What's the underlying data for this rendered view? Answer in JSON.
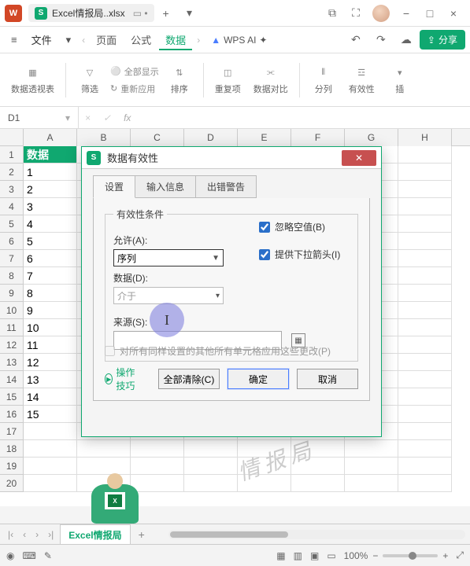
{
  "titlebar": {
    "wps_logo": "W",
    "file_icon_letter": "S",
    "file_name": "Excel情报局..xlsx",
    "add_tab": "+"
  },
  "menubar": {
    "hamburger": "≡",
    "file": "文件",
    "nav_prev": "‹",
    "page": "页面",
    "formula": "公式",
    "data": "数据",
    "nav_next": "›",
    "wps_ai_label": "WPS AI",
    "sparkle": "✦",
    "share": "分享"
  },
  "ribbon": {
    "pivot": "数据透视表",
    "filter": "筛选",
    "show_all": "全部显示",
    "reapply": "重新应用",
    "sort": "排序",
    "duplicates": "重复项",
    "compare": "数据对比",
    "split": "分列",
    "validity": "有效性",
    "insert_dd": "插"
  },
  "formula_bar": {
    "cell_ref": "D1",
    "fx": "fx"
  },
  "grid": {
    "cols": [
      "A",
      "B",
      "C",
      "D",
      "E",
      "F",
      "G",
      "H"
    ],
    "header_cell": "数据",
    "rows": [
      {
        "n": "1",
        "v": "数据"
      },
      {
        "n": "2",
        "v": "1"
      },
      {
        "n": "3",
        "v": "2"
      },
      {
        "n": "4",
        "v": "3"
      },
      {
        "n": "5",
        "v": "4"
      },
      {
        "n": "6",
        "v": "5"
      },
      {
        "n": "7",
        "v": "6"
      },
      {
        "n": "8",
        "v": "7"
      },
      {
        "n": "9",
        "v": "8"
      },
      {
        "n": "10",
        "v": "9"
      },
      {
        "n": "11",
        "v": "10"
      },
      {
        "n": "12",
        "v": "11"
      },
      {
        "n": "13",
        "v": "12"
      },
      {
        "n": "14",
        "v": "13"
      },
      {
        "n": "15",
        "v": "14"
      },
      {
        "n": "16",
        "v": "15"
      },
      {
        "n": "17",
        "v": ""
      },
      {
        "n": "18",
        "v": ""
      },
      {
        "n": "19",
        "v": ""
      },
      {
        "n": "20",
        "v": ""
      }
    ]
  },
  "watermark": "情报局",
  "sheet_tabs": {
    "tab1": "Excel情报局",
    "add": "+"
  },
  "statusbar": {
    "zoom_value": "100%",
    "minus": "−",
    "plus": "+"
  },
  "dialog": {
    "icon_letter": "S",
    "title": "数据有效性",
    "tabs": {
      "settings": "设置",
      "input_msg": "输入信息",
      "error_alert": "出错警告"
    },
    "group_legend": "有效性条件",
    "allow_label": "允许(A):",
    "allow_value": "序列",
    "data_label": "数据(D):",
    "data_value": "介于",
    "ignore_blank": "忽略空值(B)",
    "show_dropdown": "提供下拉箭头(I)",
    "source_label": "来源(S):",
    "apply_same": "对所有同样设置的其他所有单元格应用这些更改(P)",
    "tips": "操作技巧",
    "clear_all": "全部清除(C)",
    "ok": "确定",
    "cancel": "取消"
  },
  "cursor_char": "I"
}
